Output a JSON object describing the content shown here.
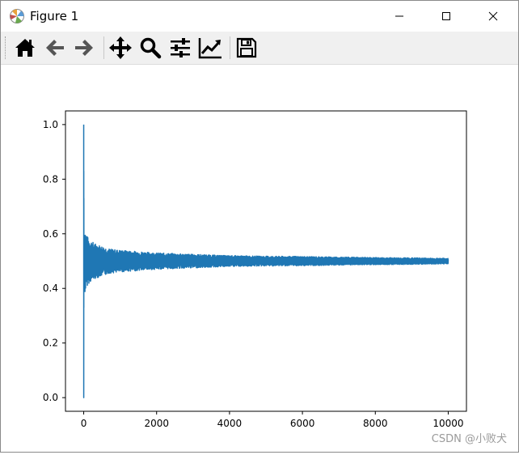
{
  "window": {
    "title": "Figure 1",
    "controls": {
      "minimize": "minimize",
      "maximize": "maximize",
      "close": "close"
    }
  },
  "toolbar": {
    "tools": [
      {
        "name": "home",
        "icon": "home-icon"
      },
      {
        "name": "back",
        "icon": "arrow-left-icon"
      },
      {
        "name": "forward",
        "icon": "arrow-right-icon"
      },
      {
        "name": "pan",
        "icon": "move-icon"
      },
      {
        "name": "zoom",
        "icon": "magnifier-icon"
      },
      {
        "name": "configure-subplots",
        "icon": "sliders-icon"
      },
      {
        "name": "edit-axis",
        "icon": "line-chart-icon"
      },
      {
        "name": "save",
        "icon": "floppy-disk-icon"
      }
    ]
  },
  "chart_data": {
    "type": "line",
    "title": "",
    "xlabel": "",
    "ylabel": "",
    "xlim": [
      -500,
      10500
    ],
    "ylim": [
      -0.05,
      1.05
    ],
    "xticks": [
      0,
      2000,
      4000,
      6000,
      8000,
      10000
    ],
    "xtick_labels": [
      "0",
      "2000",
      "4000",
      "6000",
      "8000",
      "10000"
    ],
    "yticks": [
      0.0,
      0.2,
      0.4,
      0.6,
      0.8,
      1.0
    ],
    "ytick_labels": [
      "0.0",
      "0.2",
      "0.4",
      "0.6",
      "0.8",
      "1.0"
    ],
    "grid": false,
    "legend": "none",
    "series": [
      {
        "color": "#1f77b4",
        "x": [
          0,
          1,
          2,
          3,
          4,
          5,
          8,
          10,
          15,
          20,
          30,
          50,
          80,
          100,
          150,
          200,
          300,
          400,
          500,
          700,
          1000,
          1500,
          2000,
          3000,
          4000,
          5000,
          6000,
          7000,
          8000,
          9000,
          10000
        ],
        "y_upper": [
          1.0,
          0.0,
          0.83,
          0.33,
          0.73,
          0.6,
          0.61,
          0.63,
          0.6,
          0.58,
          0.62,
          0.61,
          0.6,
          0.59,
          0.58,
          0.575,
          0.565,
          0.56,
          0.555,
          0.545,
          0.54,
          0.535,
          0.53,
          0.525,
          0.52,
          0.518,
          0.517,
          0.515,
          0.513,
          0.512,
          0.51
        ],
        "y_lower": [
          1.0,
          0.0,
          0.83,
          0.33,
          0.4,
          0.4,
          0.39,
          0.37,
          0.4,
          0.42,
          0.38,
          0.39,
          0.4,
          0.41,
          0.42,
          0.425,
          0.435,
          0.44,
          0.445,
          0.455,
          0.46,
          0.465,
          0.47,
          0.475,
          0.48,
          0.482,
          0.483,
          0.485,
          0.487,
          0.488,
          0.49
        ]
      }
    ]
  },
  "watermark": {
    "text": "CSDN @小败犬"
  }
}
